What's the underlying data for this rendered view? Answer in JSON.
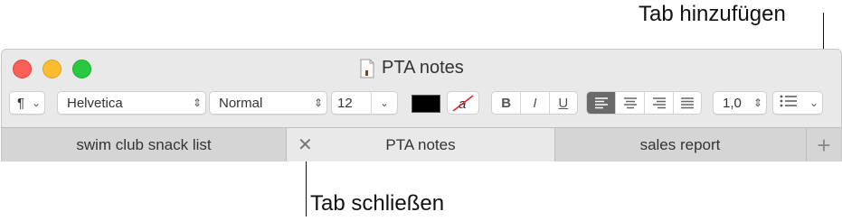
{
  "annotations": {
    "add_tab": "Tab hinzufügen",
    "close_tab": "Tab schließen"
  },
  "window": {
    "title": "PTA notes"
  },
  "toolbar": {
    "paragraph_style_symbol": "¶",
    "font_family": "Helvetica",
    "typeface": "Normal",
    "font_size": "12",
    "text_color": "#000000",
    "bold": "B",
    "italic": "I",
    "underline": "U",
    "line_spacing": "1,0"
  },
  "tabs": [
    {
      "label": "swim club snack list",
      "active": false
    },
    {
      "label": "PTA notes",
      "active": true
    },
    {
      "label": "sales report",
      "active": false
    }
  ]
}
